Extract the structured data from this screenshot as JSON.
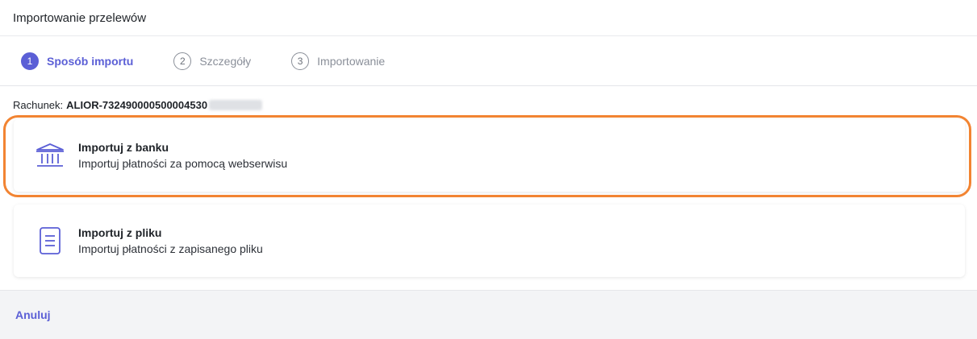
{
  "header": {
    "title": "Importowanie przelewów"
  },
  "stepper": {
    "steps": [
      {
        "num": "1",
        "label": "Sposób importu",
        "active": true
      },
      {
        "num": "2",
        "label": "Szczegóły",
        "active": false
      },
      {
        "num": "3",
        "label": "Importowanie",
        "active": false
      }
    ]
  },
  "account": {
    "label": "Rachunek:",
    "value": "ALIOR-732490000500004530"
  },
  "options": {
    "bank": {
      "title": "Importuj z banku",
      "description": "Importuj płatności za pomocą webserwisu",
      "icon": "bank-icon"
    },
    "file": {
      "title": "Importuj z pliku",
      "description": "Importuj płatności z zapisanego pliku",
      "icon": "document-icon"
    }
  },
  "footer": {
    "cancel_label": "Anuluj"
  },
  "colors": {
    "accent": "#5b5fd6",
    "highlight": "#f28432"
  }
}
